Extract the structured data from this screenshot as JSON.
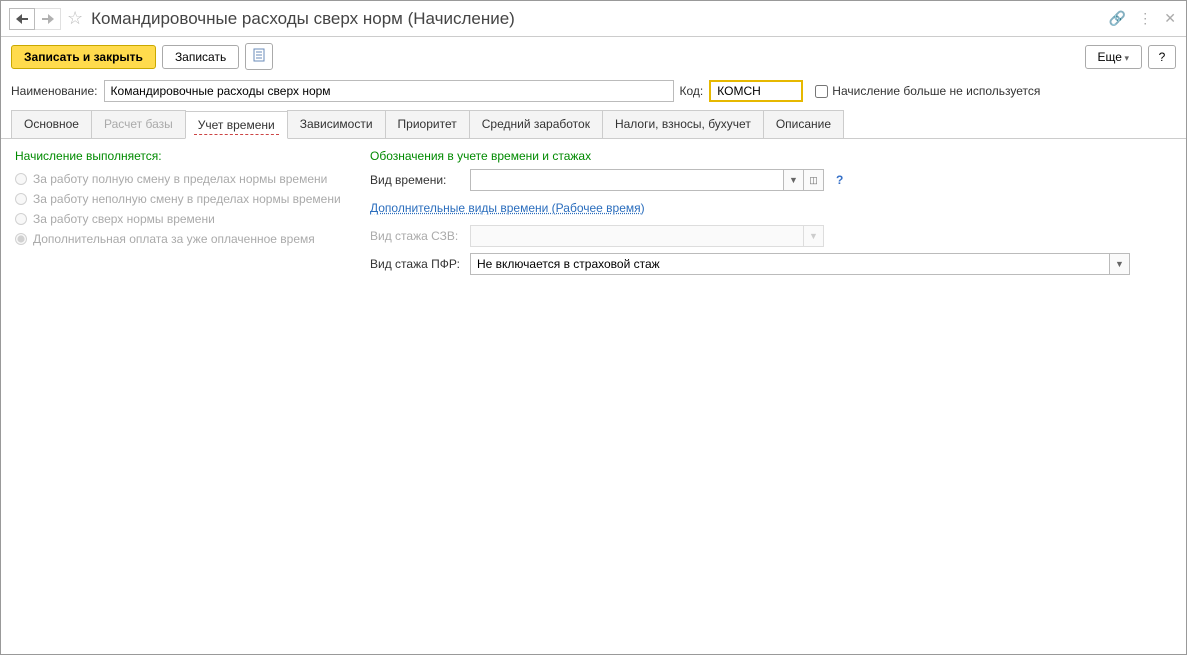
{
  "header": {
    "title": "Командировочные расходы сверх норм (Начисление)"
  },
  "toolbar": {
    "save_close": "Записать и закрыть",
    "save": "Записать",
    "more": "Еще",
    "help": "?"
  },
  "fields": {
    "name_label": "Наименование:",
    "name_value": "Командировочные расходы сверх норм",
    "code_label": "Код:",
    "code_value": "КОМСН",
    "not_used_label": "Начисление больше не используется"
  },
  "tabs": {
    "main": "Основное",
    "base": "Расчет базы",
    "time": "Учет времени",
    "deps": "Зависимости",
    "priority": "Приоритет",
    "avg": "Средний заработок",
    "tax": "Налоги, взносы, бухучет",
    "desc": "Описание"
  },
  "left": {
    "section": "Начисление выполняется:",
    "opt1": "За работу полную смену в пределах нормы времени",
    "opt2": "За работу неполную смену в пределах нормы времени",
    "opt3": "За работу сверх нормы времени",
    "opt4": "Дополнительная оплата за уже оплаченное время"
  },
  "right": {
    "section": "Обозначения в учете времени и стажах",
    "time_type_label": "Вид времени:",
    "time_type_value": "",
    "addl_link": "Дополнительные виды времени (Рабочее время)",
    "szv_label": "Вид стажа СЗВ:",
    "szv_value": "",
    "pfr_label": "Вид стажа ПФР:",
    "pfr_value": "Не включается в страховой стаж"
  }
}
